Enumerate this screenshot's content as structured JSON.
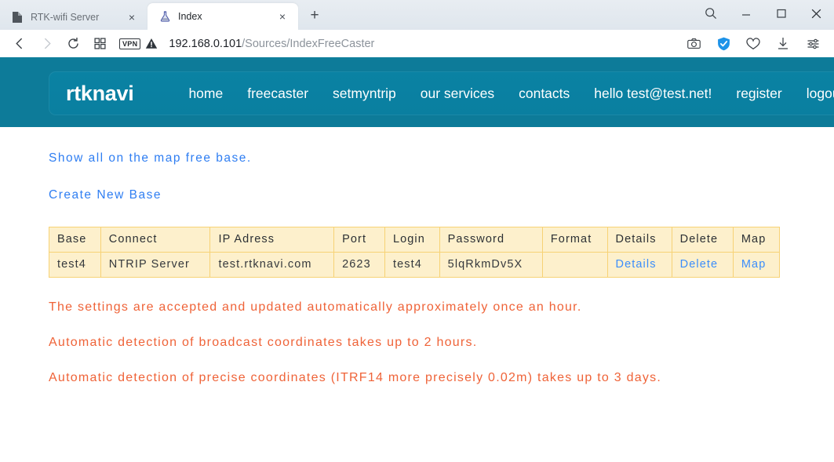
{
  "browser": {
    "tabs": [
      {
        "title": "RTK-wifi Server",
        "icon": "page-icon",
        "active": false
      },
      {
        "title": "Index",
        "icon": "flask-icon",
        "active": true
      }
    ],
    "new_tab_label": "+",
    "close_label": "×",
    "window_controls": [
      {
        "name": "search",
        "glyph": "search-icon"
      },
      {
        "name": "minimize",
        "glyph": "minimize-icon"
      },
      {
        "name": "maximize",
        "glyph": "maximize-icon"
      },
      {
        "name": "close",
        "glyph": "close-icon"
      }
    ],
    "toolbar": {
      "back": "back-icon",
      "forward": "forward-icon",
      "reload": "reload-icon",
      "panels": "grid-icon",
      "vpn_badge": "VPN",
      "warning": "warning-icon",
      "url_host": "192.168.0.101",
      "url_path": "/Sources/IndexFreeCaster",
      "right_icons": [
        "camera-icon",
        "shield-check-icon",
        "heart-icon",
        "download-icon",
        "sliders-icon"
      ]
    }
  },
  "site": {
    "brand": "rtknavi",
    "nav": [
      {
        "label": "home"
      },
      {
        "label": "freecaster"
      },
      {
        "label": "setmyntrip"
      },
      {
        "label": "our services"
      },
      {
        "label": "contacts"
      },
      {
        "label": "hello test@test.net!"
      },
      {
        "label": "register"
      },
      {
        "label": "logout"
      }
    ],
    "links": {
      "show_all": "Show all on the map free base.",
      "create_new": "Create New Base"
    },
    "table": {
      "headers": [
        "Base",
        "Connect",
        "IP Adress",
        "Port",
        "Login",
        "Password",
        "Format",
        "Details",
        "Delete",
        "Map"
      ],
      "rows": [
        {
          "base": "test4",
          "connect": "NTRIP Server",
          "ip": "test.rtknavi.com",
          "port": "2623",
          "login": "test4",
          "password": "5lqRkmDv5X",
          "format": "",
          "details": "Details",
          "delete": "Delete",
          "map": "Map"
        }
      ]
    },
    "notices": [
      "The settings are accepted and updated automatically approximately once an hour.",
      "Automatic detection of broadcast coordinates takes up to 2 hours.",
      "Automatic detection of precise coordinates (ITRF14 more precisely 0.02m) takes up to 3 days."
    ]
  },
  "colors": {
    "brand_teal": "#0d7b99",
    "navbar_teal": "#0a82a3",
    "link_blue": "#2f7ef2",
    "notice_orange": "#ef6338",
    "table_bg": "#fdf0cc",
    "table_border": "#f7d275"
  }
}
